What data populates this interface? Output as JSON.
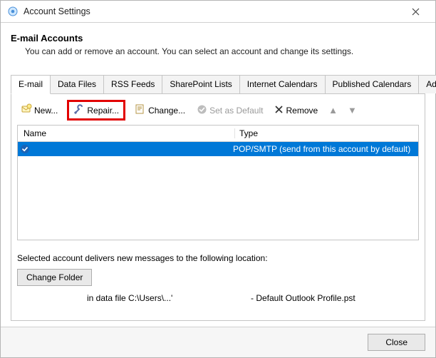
{
  "title": "Account Settings",
  "heading": "E-mail Accounts",
  "subheading": "You can add or remove an account. You can select an account and change its settings.",
  "tabs": [
    {
      "label": "E-mail"
    },
    {
      "label": "Data Files"
    },
    {
      "label": "RSS Feeds"
    },
    {
      "label": "SharePoint Lists"
    },
    {
      "label": "Internet Calendars"
    },
    {
      "label": "Published Calendars"
    },
    {
      "label": "Address Books"
    }
  ],
  "toolbar": {
    "new_label": "New...",
    "repair_label": "Repair...",
    "change_label": "Change...",
    "set_default_label": "Set as Default",
    "remove_label": "Remove"
  },
  "columns": {
    "name": "Name",
    "type": "Type"
  },
  "rows": [
    {
      "name": "",
      "type": "POP/SMTP (send from this account by default)"
    }
  ],
  "location_text": "Selected account delivers new messages to the following location:",
  "change_folder_label": "Change Folder",
  "path_prefix": "in data file C:\\Users\\...'",
  "path_suffix": "- Default Outlook Profile.pst",
  "close_label": "Close"
}
